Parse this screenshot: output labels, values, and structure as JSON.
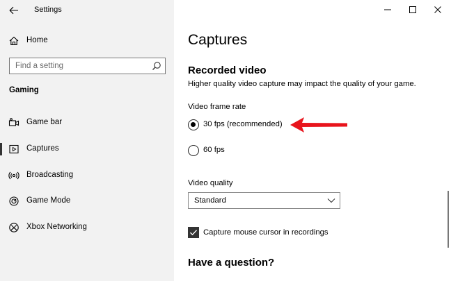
{
  "window": {
    "title": "Settings"
  },
  "sidebar": {
    "home_label": "Home",
    "search_placeholder": "Find a setting",
    "section_label": "Gaming",
    "items": [
      {
        "label": "Game bar",
        "icon": "game-bar-icon"
      },
      {
        "label": "Captures",
        "icon": "captures-icon",
        "active": true
      },
      {
        "label": "Broadcasting",
        "icon": "broadcasting-icon"
      },
      {
        "label": "Game Mode",
        "icon": "game-mode-icon"
      },
      {
        "label": "Xbox Networking",
        "icon": "xbox-icon"
      }
    ]
  },
  "main": {
    "page_title": "Captures",
    "recorded_video_title": "Recorded video",
    "recorded_video_desc": "Higher quality video capture may impact the quality of your game.",
    "frame_rate_label": "Video frame rate",
    "frame_rate_options": [
      {
        "label": "30 fps (recommended)",
        "selected": true
      },
      {
        "label": "60 fps",
        "selected": false
      }
    ],
    "quality_label": "Video quality",
    "quality_value": "Standard",
    "capture_cursor_label": "Capture mouse cursor in recordings",
    "capture_cursor_checked": true,
    "question_title": "Have a question?"
  },
  "colors": {
    "sidebar_bg": "#f2f2f2",
    "annotation_arrow": "#e8141c",
    "checkbox_fill": "#333333"
  }
}
